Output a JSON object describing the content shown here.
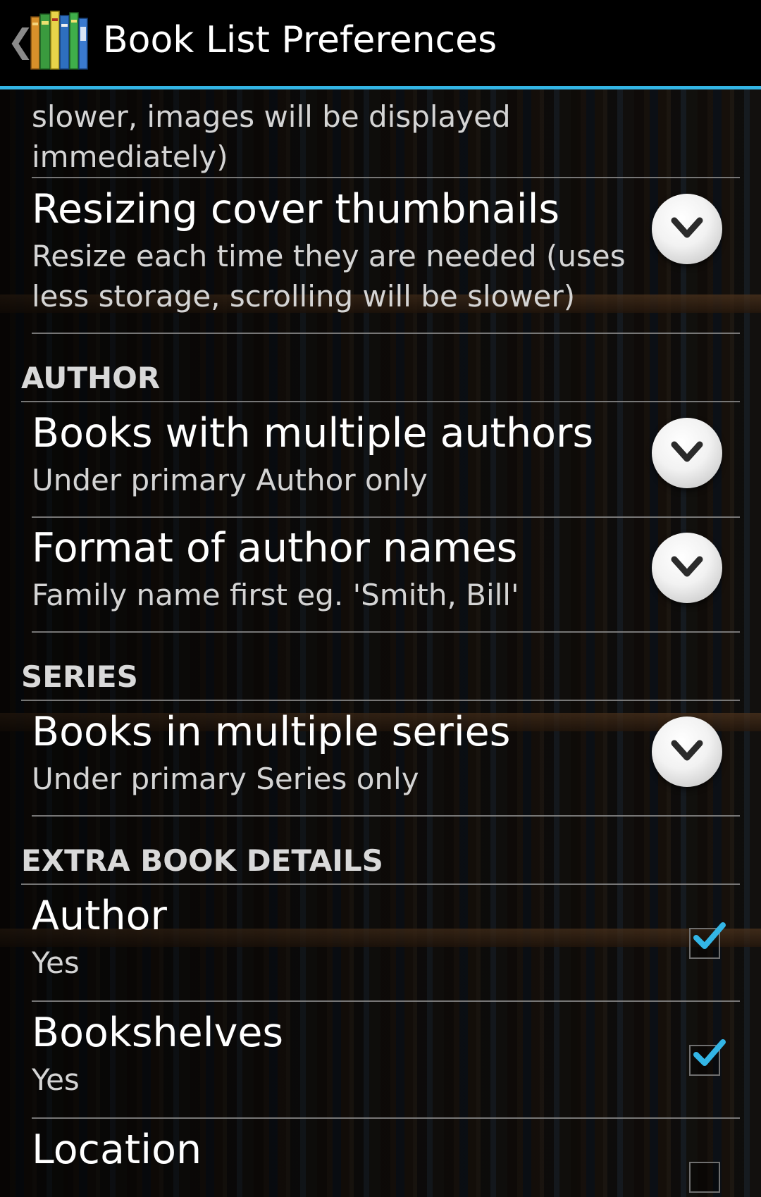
{
  "action_bar": {
    "title": "Book List Preferences",
    "back_icon": "chevron-left-icon",
    "app_icon": "book-stack-icon",
    "accent_color": "#33b5e5"
  },
  "partial_item": {
    "summary": "slower, images will be displayed immediately)"
  },
  "items": {
    "resizing": {
      "title": "Resizing cover thumbnails",
      "summary": "Resize each time they are needed (uses less storage, scrolling will be slower)"
    },
    "multiple_authors": {
      "title": "Books with multiple authors",
      "summary": "Under primary Author only"
    },
    "author_format": {
      "title": "Format of author names",
      "summary": "Family name first eg. 'Smith, Bill'"
    },
    "multiple_series": {
      "title": "Books in multiple series",
      "summary": "Under primary Series only"
    },
    "author": {
      "title": "Author",
      "summary": "Yes",
      "checked": true
    },
    "bookshelves": {
      "title": "Bookshelves",
      "summary": "Yes",
      "checked": true
    },
    "location": {
      "title": "Location",
      "checked": false
    }
  },
  "categories": {
    "author": "AUTHOR",
    "series": "SERIES",
    "extra": "EXTRA BOOK DETAILS"
  },
  "colors": {
    "check_blue": "#33b5e5",
    "divider": "#8a8a8a"
  }
}
